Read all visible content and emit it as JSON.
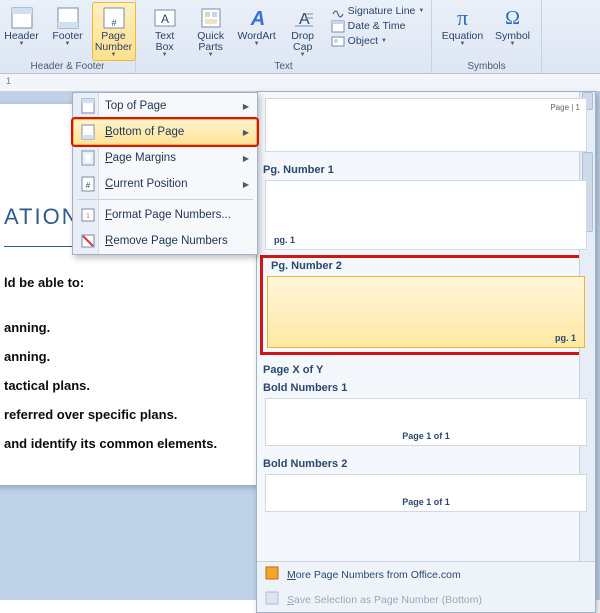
{
  "ribbon": {
    "groups": {
      "header_footer": {
        "label": "Header & Footer",
        "header": "Header",
        "footer": "Footer",
        "page_number": "Page\nNumber"
      },
      "text": {
        "label": "Text",
        "text_box": "Text\nBox",
        "quick_parts": "Quick\nParts",
        "wordart": "WordArt",
        "drop_cap": "Drop\nCap",
        "signature": "Signature Line",
        "datetime": "Date & Time",
        "object": "Object"
      },
      "symbols": {
        "label": "Symbols",
        "equation": "Equation",
        "symbol": "Symbol"
      }
    }
  },
  "ruler": {
    "text": "1"
  },
  "submenu": {
    "top": "Top of Page",
    "bottom": "Bottom of Page",
    "margins": "Page Margins",
    "current": "Current Position",
    "format": "Format Page Numbers...",
    "remove": "Remove Page Numbers"
  },
  "gallery": {
    "toprightpage": "Page | 1",
    "pg1": {
      "title": "Pg. Number 1",
      "footer": "pg. 1"
    },
    "pg2": {
      "title": "Pg. Number 2",
      "footer": "pg. 1"
    },
    "pagexy": "Page X of Y",
    "bold1": {
      "title": "Bold Numbers 1",
      "footer": "Page 1 of 1"
    },
    "bold2": {
      "title": "Bold Numbers 2",
      "footer": "Page 1 of 1"
    },
    "more": "More Page Numbers from Office.com",
    "save": "Save Selection as Page Number (Bottom)"
  },
  "doc": {
    "title": "ATIONS OF",
    "lines": {
      "l1": "ld be able to:",
      "l2": "anning.",
      "l3": "anning.",
      "l4": "tactical plans.",
      "l5": "referred over specific plans.",
      "l6": "and identify its common elements."
    }
  }
}
